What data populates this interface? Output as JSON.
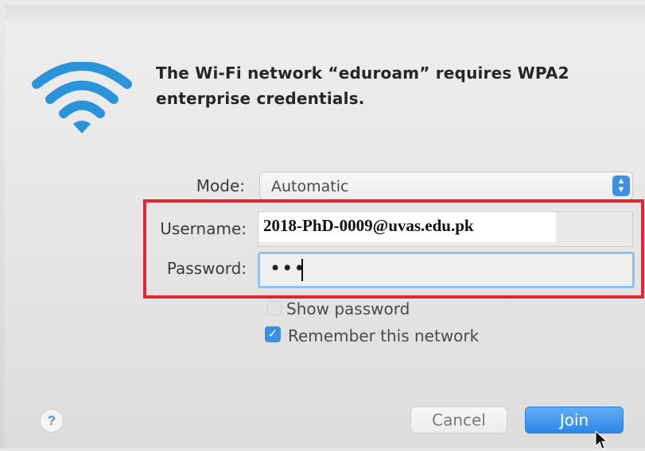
{
  "dialog": {
    "title": "The Wi-Fi network “eduroam” requires WPA2 enterprise credentials."
  },
  "mode": {
    "label": "Mode:",
    "value": "Automatic"
  },
  "username": {
    "label": "Username:",
    "value": "2018-PhD-0009@uvas.edu.pk"
  },
  "password": {
    "label": "Password:",
    "masked_value": "•••"
  },
  "options": {
    "show_password": {
      "label": "Show password",
      "checked": false
    },
    "remember_network": {
      "label": "Remember this network",
      "checked": true
    }
  },
  "buttons": {
    "help": "?",
    "cancel": "Cancel",
    "join": "Join"
  },
  "colors": {
    "accent": "#3d8fe6",
    "highlight_box": "#e3262b"
  },
  "icons": {
    "wifi": "wifi-icon",
    "select_arrows": "chevron-updown-icon",
    "checkmark": "checkmark-icon",
    "cursor": "mouse-pointer-icon"
  }
}
